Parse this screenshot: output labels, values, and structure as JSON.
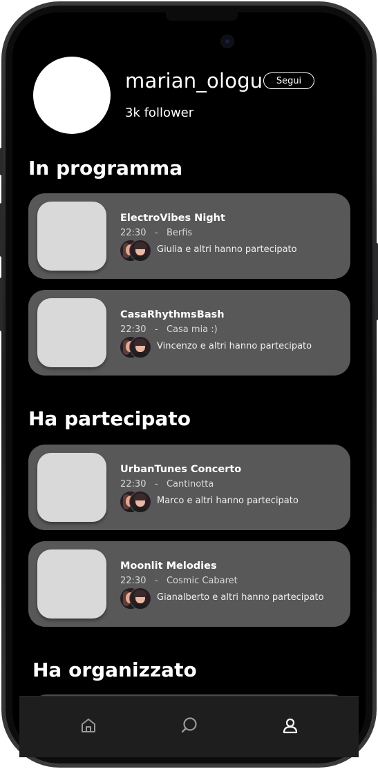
{
  "profile": {
    "username": "marian_ologu",
    "follow_label": "Segui",
    "followers": "3k follower"
  },
  "sections": {
    "upcoming_title": "In programma",
    "attended_title": "Ha partecipato",
    "organized_title": "Ha organizzato"
  },
  "upcoming": [
    {
      "title": "ElectroVibes Night",
      "time": "22:30",
      "venue": "Berfis",
      "participants": "Giulia e altri hanno partecipato"
    },
    {
      "title": "CasaRhythmsBash",
      "time": "22:30",
      "venue": "Casa mia :)",
      "participants": "Vincenzo e altri hanno partecipato"
    }
  ],
  "attended": [
    {
      "title": "UrbanTunes Concerto",
      "time": "22:30",
      "venue": "Cantinotta",
      "participants": "Marco e altri hanno partecipato"
    },
    {
      "title": "Moonlit Melodies",
      "time": "22:30",
      "venue": "Cosmic Cabaret",
      "participants": "Gianalberto e altri hanno partecipato"
    }
  ],
  "meta_separator": "-",
  "nav": {
    "items": [
      "home-icon",
      "search-icon",
      "profile-icon"
    ],
    "active": "profile-icon"
  },
  "colors": {
    "background": "#000000",
    "card": "#585858",
    "thumb": "#d9d9d9",
    "text": "#ffffff"
  }
}
